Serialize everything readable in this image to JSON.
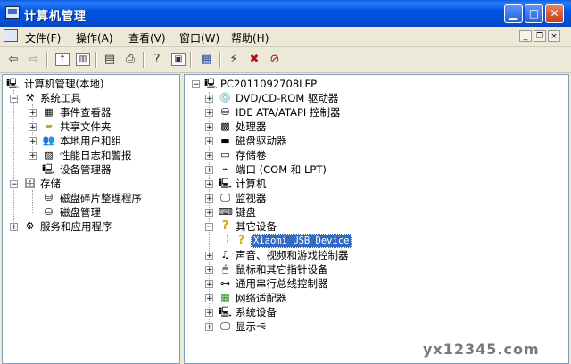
{
  "window": {
    "title": "计算机管理"
  },
  "menu": [
    {
      "label": "文件(F)"
    },
    {
      "label": "操作(A)"
    },
    {
      "label": "查看(V)"
    },
    {
      "label": "窗口(W)"
    },
    {
      "label": "帮助(H)"
    }
  ],
  "left_tree": [
    {
      "label": "计算机管理(本地)",
      "icon": "computer-management-icon"
    },
    {
      "label": "系统工具",
      "icon": "tools-icon"
    },
    {
      "label": "事件查看器",
      "icon": "event-viewer-icon"
    },
    {
      "label": "共享文件夹",
      "icon": "shared-folder-icon"
    },
    {
      "label": "本地用户和组",
      "icon": "users-icon"
    },
    {
      "label": "性能日志和警报",
      "icon": "performance-icon"
    },
    {
      "label": "设备管理器",
      "icon": "device-manager-icon"
    },
    {
      "label": "存储",
      "icon": "storage-icon"
    },
    {
      "label": "磁盘碎片整理程序",
      "icon": "defrag-icon"
    },
    {
      "label": "磁盘管理",
      "icon": "disk-management-icon"
    },
    {
      "label": "服务和应用程序",
      "icon": "services-icon"
    }
  ],
  "right_tree": [
    {
      "label": "PC2011092708LFP",
      "icon": "computer-icon"
    },
    {
      "label": "DVD/CD-ROM 驱动器",
      "icon": "cdrom-icon"
    },
    {
      "label": "IDE ATA/ATAPI 控制器",
      "icon": "ide-icon"
    },
    {
      "label": "处理器",
      "icon": "processor-icon"
    },
    {
      "label": "磁盘驱动器",
      "icon": "disk-drive-icon"
    },
    {
      "label": "存储卷",
      "icon": "storage-volume-icon"
    },
    {
      "label": "端口 (COM 和 LPT)",
      "icon": "port-icon"
    },
    {
      "label": "计算机",
      "icon": "computer-icon"
    },
    {
      "label": "监视器",
      "icon": "monitor-icon"
    },
    {
      "label": "键盘",
      "icon": "keyboard-icon"
    },
    {
      "label": "其它设备",
      "icon": "unknown-device-icon"
    },
    {
      "label": "Xiaomi USB Device",
      "icon": "unknown-device-icon"
    },
    {
      "label": "声音、视频和游戏控制器",
      "icon": "sound-icon"
    },
    {
      "label": "鼠标和其它指针设备",
      "icon": "mouse-icon"
    },
    {
      "label": "通用串行总线控制器",
      "icon": "usb-icon"
    },
    {
      "label": "网络适配器",
      "icon": "network-icon"
    },
    {
      "label": "系统设备",
      "icon": "system-device-icon"
    },
    {
      "label": "显示卡",
      "icon": "display-icon"
    }
  ],
  "watermark": "yx12345.com"
}
